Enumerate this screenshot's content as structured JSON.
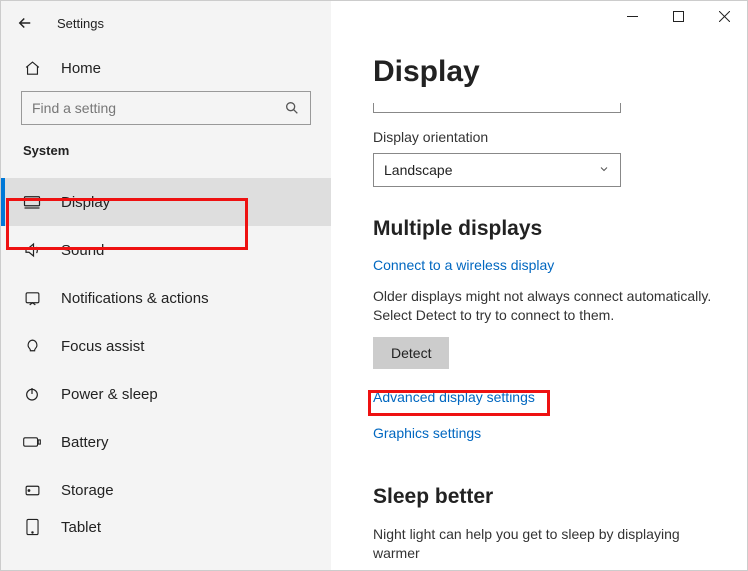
{
  "app_title": "Settings",
  "home_label": "Home",
  "search_placeholder": "Find a setting",
  "category": "System",
  "sidebar": {
    "items": [
      {
        "label": "Display"
      },
      {
        "label": "Sound"
      },
      {
        "label": "Notifications & actions"
      },
      {
        "label": "Focus assist"
      },
      {
        "label": "Power & sleep"
      },
      {
        "label": "Battery"
      },
      {
        "label": "Storage"
      },
      {
        "label": "Tablet"
      }
    ]
  },
  "main": {
    "page_title": "Display",
    "orientation_label": "Display orientation",
    "orientation_value": "Landscape",
    "multi_title": "Multiple displays",
    "wireless_link": "Connect to a wireless display",
    "older_text": "Older displays might not always connect automatically. Select Detect to try to connect to them.",
    "detect_label": "Detect",
    "adv_link": "Advanced display settings",
    "gfx_link": "Graphics settings",
    "sleep_title": "Sleep better",
    "sleep_text": "Night light can help you get to sleep by displaying warmer"
  }
}
